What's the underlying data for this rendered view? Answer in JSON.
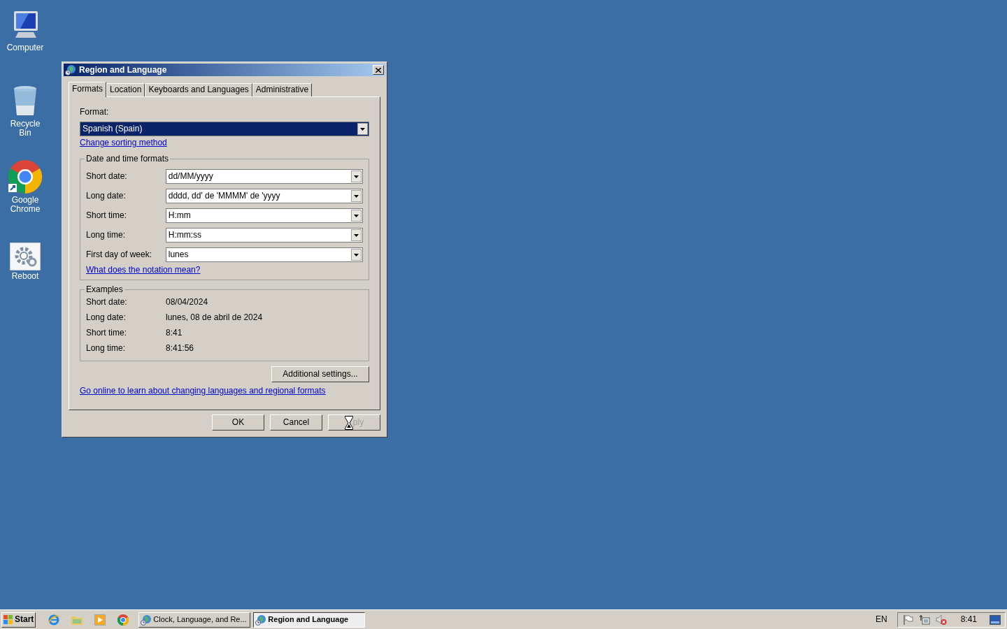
{
  "desktop_icons": [
    {
      "kind": "computer",
      "label": "Computer"
    },
    {
      "kind": "bin",
      "label": "Recycle Bin"
    },
    {
      "kind": "chrome",
      "label": "Google Chrome"
    },
    {
      "kind": "reboot",
      "label": "Reboot"
    }
  ],
  "dialog": {
    "title": "Region and Language",
    "tabs": [
      {
        "label": "Formats",
        "selected": true
      },
      {
        "label": "Location",
        "selected": false
      },
      {
        "label": "Keyboards and Languages",
        "selected": false
      },
      {
        "label": "Administrative",
        "selected": false
      }
    ],
    "format_label": "Format:",
    "format_value": "Spanish (Spain)",
    "sort_link": "Change sorting method",
    "date_time_group": {
      "title": "Date and time formats",
      "rows": [
        {
          "label": "Short date:",
          "value": "dd/MM/yyyy"
        },
        {
          "label": "Long date:",
          "value": "dddd, dd' de 'MMMM' de 'yyyy"
        },
        {
          "label": "Short time:",
          "value": "H:mm"
        },
        {
          "label": "Long time:",
          "value": "H:mm:ss"
        },
        {
          "label": "First day of week:",
          "value": "lunes"
        }
      ],
      "link": "What does the notation mean?"
    },
    "examples": {
      "title": "Examples",
      "rows": [
        {
          "label": "Short date:",
          "value": "08/04/2024"
        },
        {
          "label": "Long date:",
          "value": "lunes, 08 de abril de 2024"
        },
        {
          "label": "Short time:",
          "value": "8:41"
        },
        {
          "label": "Long time:",
          "value": "8:41:56"
        }
      ]
    },
    "additional_button": "Additional settings...",
    "online_link": "Go online to learn about changing languages and regional formats",
    "buttons": [
      {
        "label": "OK",
        "disabled": false,
        "busy_cursor": false
      },
      {
        "label": "Cancel",
        "disabled": false,
        "busy_cursor": false
      },
      {
        "label": "ply",
        "disabled": true,
        "busy_cursor": true
      }
    ]
  },
  "taskbar": {
    "start": "Start",
    "quick_launch": [
      {
        "kind": "ie"
      },
      {
        "kind": "folder"
      },
      {
        "kind": "media"
      },
      {
        "kind": "chrome"
      }
    ],
    "tasks": [
      {
        "label": "Clock, Language, and Re...",
        "selected": false
      },
      {
        "label": "Region and Language",
        "selected": true
      }
    ],
    "language": "EN",
    "tray": [
      {
        "kind": "flag"
      },
      {
        "kind": "network"
      },
      {
        "kind": "sound-muted"
      }
    ],
    "clock": "8:41"
  }
}
